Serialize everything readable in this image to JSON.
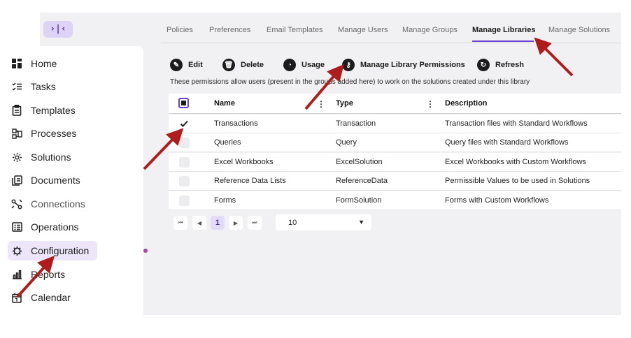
{
  "collapse_toggle": "›|‹",
  "sidebar": {
    "items": [
      {
        "label": "Home",
        "icon": "grid-icon"
      },
      {
        "label": "Tasks",
        "icon": "checklist-icon"
      },
      {
        "label": "Templates",
        "icon": "clipboard-icon"
      },
      {
        "label": "Processes",
        "icon": "process-icon"
      },
      {
        "label": "Solutions",
        "icon": "cog-icon"
      },
      {
        "label": "Documents",
        "icon": "documents-icon"
      },
      {
        "label": "Connections",
        "icon": "connections-icon"
      },
      {
        "label": "Operations",
        "icon": "operations-icon"
      },
      {
        "label": "Configuration",
        "icon": "configuration-icon",
        "active": true
      },
      {
        "label": "Reports",
        "icon": "bar-chart-icon"
      },
      {
        "label": "Calendar",
        "icon": "calendar-icon"
      }
    ]
  },
  "tabs": [
    "Policies",
    "Preferences",
    "Email Templates",
    "Manage Users",
    "Manage Groups",
    "Manage Libraries",
    "Manage Solutions"
  ],
  "active_tab": "Manage Libraries",
  "toolbar": {
    "edit": "Edit",
    "delete": "Delete",
    "usage": "Usage",
    "permissions": "Manage Library Permissions",
    "refresh": "Refresh"
  },
  "hint": "These permissions allow users (present in the groups added here) to work on the solutions created under this library",
  "table": {
    "headers": {
      "name": "Name",
      "type": "Type",
      "description": "Description"
    },
    "rows": [
      {
        "name": "Transactions",
        "type": "Transaction",
        "description": "Transaction files with Standard Workflows",
        "checked": true
      },
      {
        "name": "Queries",
        "type": "Query",
        "description": "Query files with Standard Workflows",
        "checked": false
      },
      {
        "name": "Excel Workbooks",
        "type": "ExcelSolution",
        "description": "Excel Workbooks with Custom Workflows",
        "checked": false
      },
      {
        "name": "Reference Data Lists",
        "type": "ReferenceData",
        "description": "Permissible Values to be used in Solutions",
        "checked": false
      },
      {
        "name": "Forms",
        "type": "FormSolution",
        "description": "Forms with Custom Workflows",
        "checked": false
      }
    ]
  },
  "pager": {
    "first": "⏮",
    "prev": "◀",
    "page": "1",
    "next": "▶",
    "last": "⏭",
    "page_size": "10"
  },
  "colors": {
    "accent": "#6b3fd6",
    "arrow": "#b01c1c",
    "active_bg": "#ece6f8"
  }
}
